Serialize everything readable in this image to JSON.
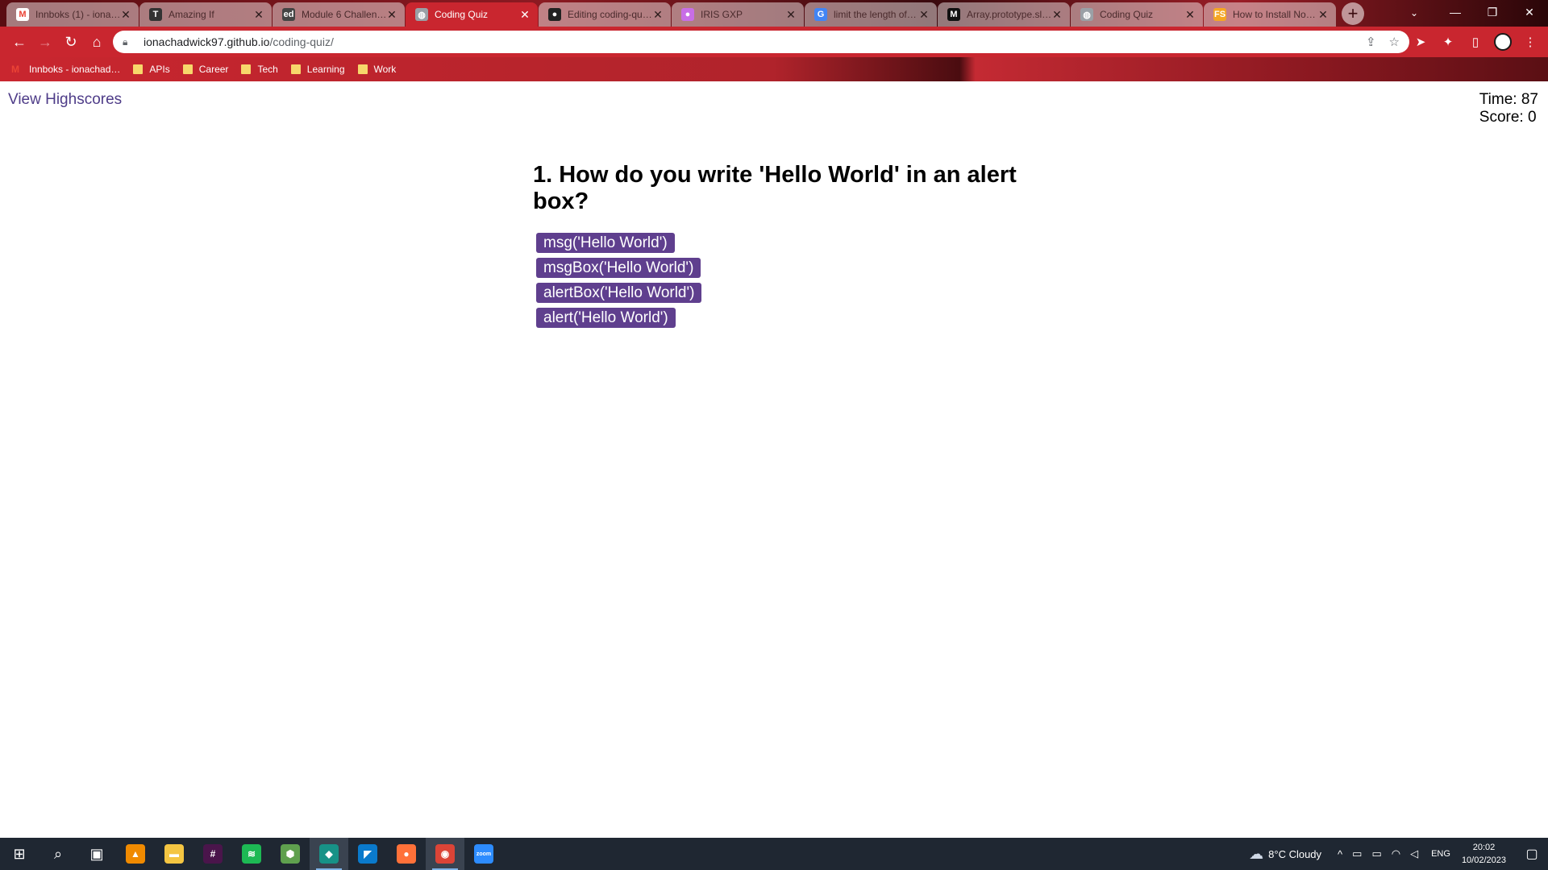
{
  "browser": {
    "tabs": [
      {
        "label": "Innboks (1) - iona…",
        "favicon": "gmail-icon",
        "fav_color": "#ffffff",
        "fav_text": "M"
      },
      {
        "label": "Amazing If",
        "favicon": "t-icon",
        "fav_color": "#333333",
        "fav_text": "T"
      },
      {
        "label": "Module 6 Challen…",
        "favicon": "edx-icon",
        "fav_color": "#444444",
        "fav_text": "ed"
      },
      {
        "label": "Coding Quiz",
        "favicon": "globe-icon",
        "fav_color": "#9aa0a6",
        "fav_text": "◍",
        "active": true
      },
      {
        "label": "Editing coding-qu…",
        "favicon": "github-icon",
        "fav_color": "#222222",
        "fav_text": "●"
      },
      {
        "label": "IRIS GXP",
        "favicon": "iris-icon",
        "fav_color": "#c86ee6",
        "fav_text": "●"
      },
      {
        "label": "limit the length of…",
        "favicon": "google-icon",
        "fav_color": "#4285f4",
        "fav_text": "G"
      },
      {
        "label": "Array.prototype.sl…",
        "favicon": "mdn-icon",
        "fav_color": "#111111",
        "fav_text": "M"
      },
      {
        "label": "Coding Quiz",
        "favicon": "globe-icon",
        "fav_color": "#9aa0a6",
        "fav_text": "◍"
      },
      {
        "label": "How to Install No…",
        "favicon": "fs-icon",
        "fav_color": "#f5a623",
        "fav_text": "FS"
      }
    ],
    "url_host": "ionachadwick97.github.io",
    "url_path": "/coding-quiz/",
    "bookmarks": [
      {
        "label": "Innboks - ionachad…",
        "type": "gmail"
      },
      {
        "label": "APIs",
        "type": "folder"
      },
      {
        "label": "Career",
        "type": "folder"
      },
      {
        "label": "Tech",
        "type": "folder"
      },
      {
        "label": "Learning",
        "type": "folder"
      },
      {
        "label": "Work",
        "type": "folder"
      }
    ]
  },
  "page": {
    "highscores_link": "View Highscores",
    "time_label": "Time: 87",
    "score_label": "Score: 0",
    "question": "1. How do you write 'Hello World' in an alert box?",
    "choices": [
      "msg('Hello World')",
      "msgBox('Hello World')",
      "alertBox('Hello World')",
      "alert('Hello World')"
    ]
  },
  "taskbar": {
    "apps": [
      {
        "name": "windows-start-icon",
        "glyph": "⊞"
      },
      {
        "name": "search-icon",
        "glyph": "⌕"
      },
      {
        "name": "task-view-icon",
        "glyph": "▣"
      },
      {
        "name": "vlc-icon",
        "glyph": "▲",
        "color": "#f08a00"
      },
      {
        "name": "file-explorer-icon",
        "glyph": "▬",
        "color": "#f4c542"
      },
      {
        "name": "slack-icon",
        "glyph": "#",
        "color": "#4a154b"
      },
      {
        "name": "spotify-icon",
        "glyph": "≋",
        "color": "#1db954"
      },
      {
        "name": "node-icon",
        "glyph": "⬢",
        "color": "#5fa04e"
      },
      {
        "name": "gitkraken-icon",
        "glyph": "◆",
        "color": "#179287",
        "active": true
      },
      {
        "name": "vscode-icon",
        "glyph": "◤",
        "color": "#0a7acc"
      },
      {
        "name": "firefox-icon",
        "glyph": "●",
        "color": "#ff7139"
      },
      {
        "name": "chrome-icon",
        "glyph": "◉",
        "color": "#db4437",
        "active": true
      },
      {
        "name": "zoom-icon",
        "glyph": "zoom",
        "color": "#2d8cff"
      }
    ],
    "weather": "8°C  Cloudy",
    "language": "ENG",
    "time": "20:02",
    "date": "10/02/2023"
  },
  "colors": {
    "accent": "#c9262f",
    "choice_bg": "#5f3f8e",
    "link": "#4e3c88"
  }
}
